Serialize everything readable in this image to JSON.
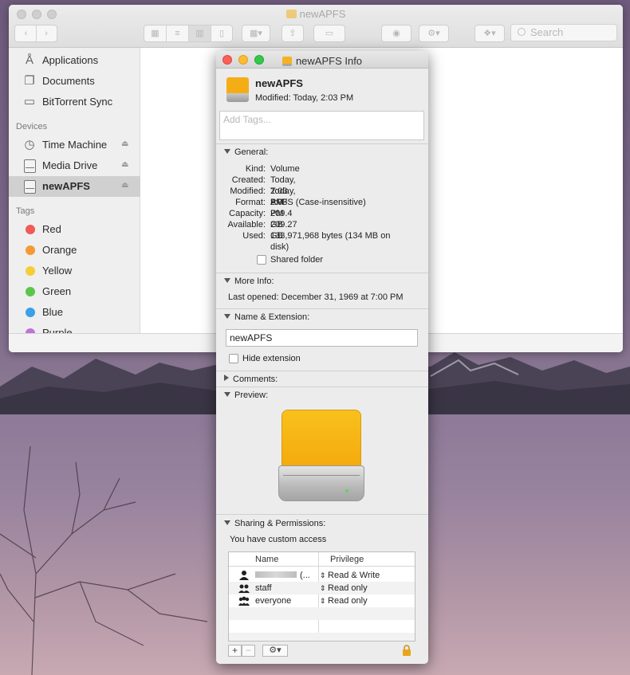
{
  "finder": {
    "title": "newAPFS",
    "search_placeholder": "Search",
    "sidebar": {
      "favorites": [
        {
          "label": "Applications",
          "icon": "applications-icon"
        },
        {
          "label": "Documents",
          "icon": "documents-icon"
        },
        {
          "label": "BitTorrent Sync",
          "icon": "folder-icon"
        }
      ],
      "devices_header": "Devices",
      "devices": [
        {
          "label": "Time Machine",
          "icon": "time-machine-icon"
        },
        {
          "label": "Media Drive",
          "icon": "drive-icon"
        },
        {
          "label": "newAPFS",
          "icon": "drive-icon"
        }
      ],
      "tags_header": "Tags",
      "tags": [
        {
          "label": "Red",
          "color": "#f05a57"
        },
        {
          "label": "Orange",
          "color": "#f59a33"
        },
        {
          "label": "Yellow",
          "color": "#f5cd37"
        },
        {
          "label": "Green",
          "color": "#5cc64a"
        },
        {
          "label": "Blue",
          "color": "#3aa0e8"
        },
        {
          "label": "Purple",
          "color": "#c471d7"
        }
      ]
    }
  },
  "info": {
    "title": "newAPFS Info",
    "name": "newAPFS",
    "modified": "Modified: Today, 2:03 PM",
    "tags_placeholder": "Add Tags...",
    "general": {
      "header": "General:",
      "rows": [
        {
          "key": "Kind:",
          "value": "Volume"
        },
        {
          "key": "Created:",
          "value": "Today, 2:03 PM"
        },
        {
          "key": "Modified:",
          "value": "Today, 2:03 PM"
        },
        {
          "key": "Format:",
          "value": "APFS (Case-insensitive)"
        },
        {
          "key": "Capacity:",
          "value": "209.4 GB"
        },
        {
          "key": "Available:",
          "value": "209.27 GB"
        },
        {
          "key": "Used:",
          "value": "133,971,968 bytes (134 MB on"
        },
        {
          "key": "",
          "value": "disk)"
        }
      ],
      "shared_folder": "Shared folder"
    },
    "more_info": {
      "header": "More Info:",
      "last_opened": "Last opened: December 31, 1969 at 7:00 PM"
    },
    "name_ext": {
      "header": "Name & Extension:",
      "value": "newAPFS",
      "hide_extension": "Hide extension"
    },
    "comments": {
      "header": "Comments:"
    },
    "preview": {
      "header": "Preview:"
    },
    "sharing": {
      "header": "Sharing & Permissions:",
      "access_text": "You have custom access",
      "col_name": "Name",
      "col_privilege": "Privilege",
      "rows": [
        {
          "name": "(...",
          "privilege": "Read & Write",
          "icon": "user-icon"
        },
        {
          "name": "staff",
          "privilege": "Read only",
          "icon": "group-icon"
        },
        {
          "name": "everyone",
          "privilege": "Read only",
          "icon": "everyone-icon"
        }
      ]
    }
  }
}
